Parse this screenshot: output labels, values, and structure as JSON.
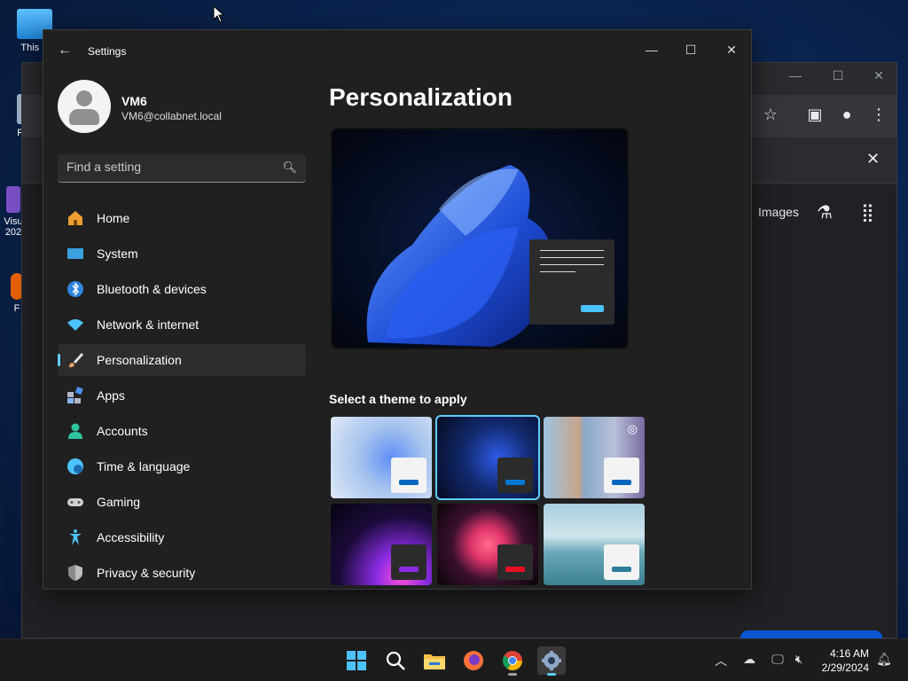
{
  "desktop": {
    "icons": [
      {
        "label": "This P",
        "name": "this-pc"
      },
      {
        "label": "Rec",
        "name": "recycle-bin"
      },
      {
        "label": "Visu\n202",
        "name": "visual-studio"
      },
      {
        "label": "F",
        "name": "firefox-shortcut"
      }
    ]
  },
  "chrome": {
    "images_label": "Images"
  },
  "settings": {
    "window_title": "Settings",
    "user": {
      "name": "VM6",
      "email": "VM6@collabnet.local"
    },
    "search_placeholder": "Find a setting",
    "nav": [
      {
        "label": "Home",
        "icon": "home-icon",
        "color": "#f0a030"
      },
      {
        "label": "System",
        "icon": "system-icon",
        "color": "#3aa0e0"
      },
      {
        "label": "Bluetooth & devices",
        "icon": "bluetooth-icon",
        "color": "#2e86de"
      },
      {
        "label": "Network & internet",
        "icon": "wifi-icon",
        "color": "#4cc2ff"
      },
      {
        "label": "Personalization",
        "icon": "brush-icon",
        "color": "#e8a060",
        "active": true
      },
      {
        "label": "Apps",
        "icon": "apps-icon",
        "color": "#8ab4f8"
      },
      {
        "label": "Accounts",
        "icon": "accounts-icon",
        "color": "#2ec4a0"
      },
      {
        "label": "Time & language",
        "icon": "globe-icon",
        "color": "#4cc2ff"
      },
      {
        "label": "Gaming",
        "icon": "gamepad-icon",
        "color": "#cfcfcf"
      },
      {
        "label": "Accessibility",
        "icon": "accessibility-icon",
        "color": "#4cc2ff"
      },
      {
        "label": "Privacy & security",
        "icon": "shield-icon",
        "color": "#bdbdbd"
      }
    ],
    "page_title": "Personalization",
    "theme_heading": "Select a theme to apply",
    "themes": [
      {
        "name": "windows-light",
        "accent": "#0067c0",
        "selected": false
      },
      {
        "name": "windows-dark",
        "accent": "#0078d4",
        "selected": true
      },
      {
        "name": "windows-spotlight",
        "accent": "#0067c0",
        "selected": false
      },
      {
        "name": "glow",
        "accent": "#8a2be2",
        "selected": false
      },
      {
        "name": "captured-motion",
        "accent": "#e81123",
        "selected": false
      },
      {
        "name": "flow",
        "accent": "#2d7d9a",
        "selected": false
      }
    ]
  },
  "taskbar": {
    "apps": [
      "start",
      "search",
      "file-explorer",
      "firefox",
      "chrome",
      "settings"
    ],
    "time": "4:16 AM",
    "date": "2/29/2024"
  }
}
